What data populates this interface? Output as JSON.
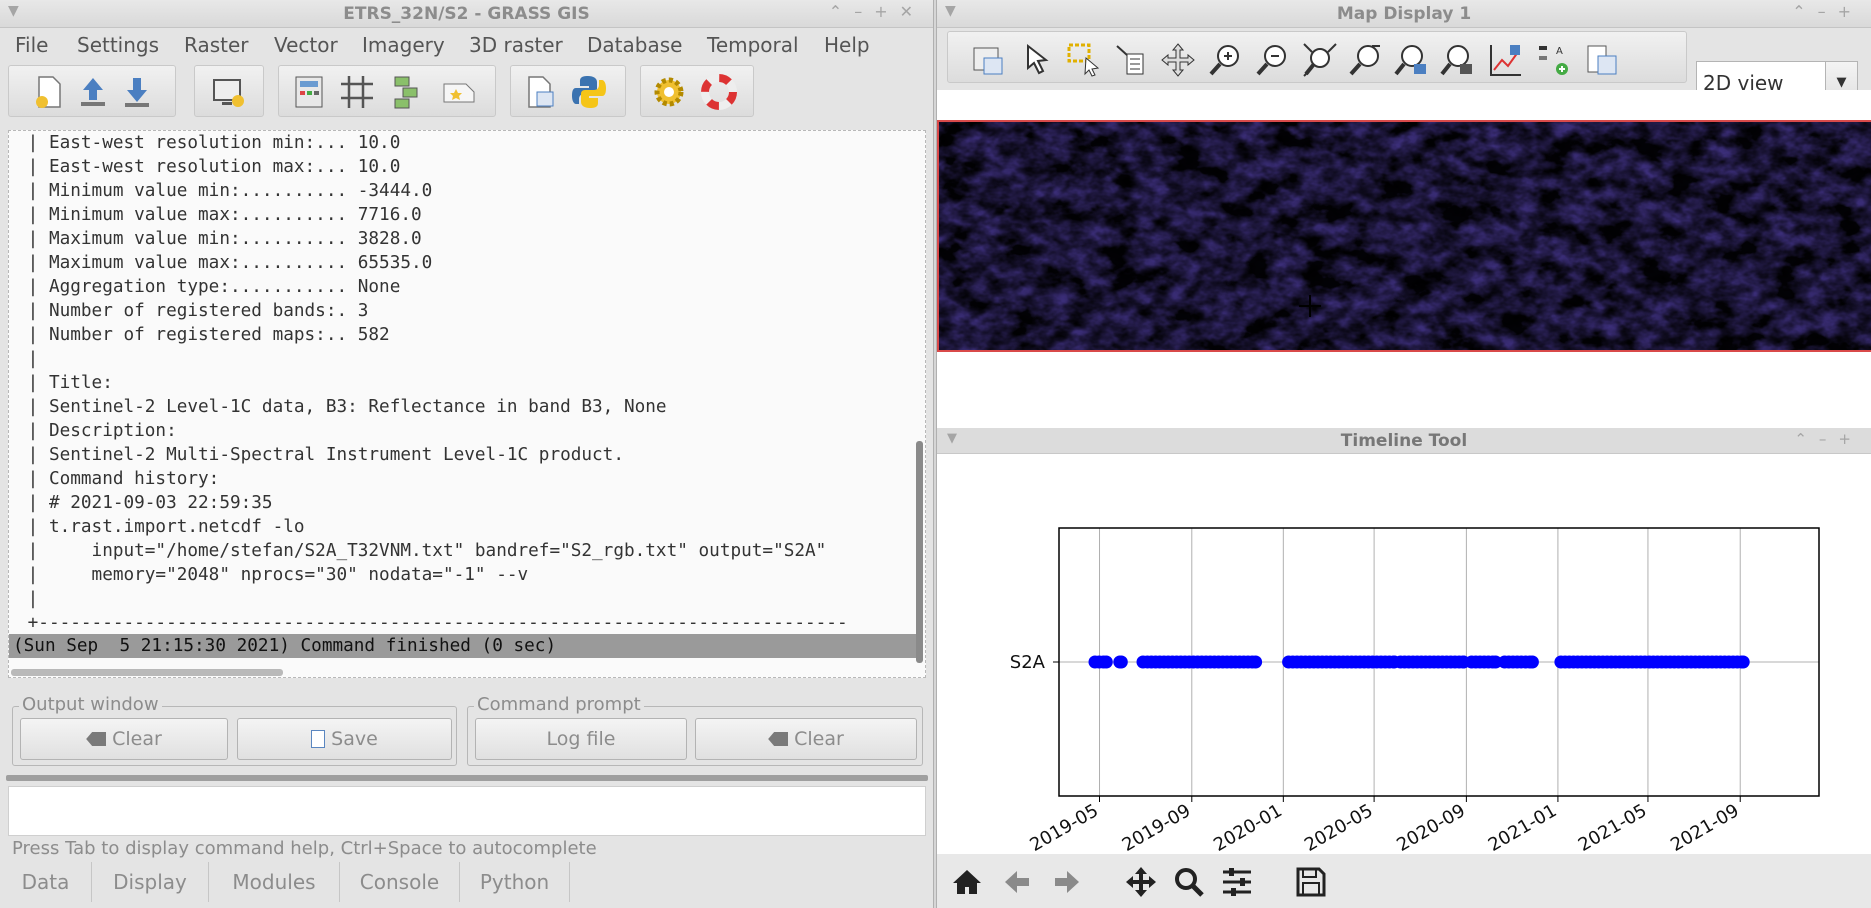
{
  "grass": {
    "title": "ETRS_32N/S2 - GRASS GIS",
    "menu": [
      "File",
      "Settings",
      "Raster",
      "Vector",
      "Imagery",
      "3D raster",
      "Database",
      "Temporal",
      "Help"
    ],
    "console_lines": [
      " | East-west resolution min:... 10.0",
      " | East-west resolution max:... 10.0",
      " | Minimum value min:.......... -3444.0",
      " | Minimum value max:.......... 7716.0",
      " | Maximum value min:.......... 3828.0",
      " | Maximum value max:.......... 65535.0",
      " | Aggregation type:........... None",
      " | Number of registered bands:. 3",
      " | Number of registered maps:.. 582",
      " |",
      " | Title:",
      " | Sentinel-2 Level-1C data, B3: Reflectance in band B3, None",
      " | Description:",
      " | Sentinel-2 Multi-Spectral Instrument Level-1C product.",
      " | Command history:",
      " | # 2021-09-03 22:59:35",
      " | t.rast.import.netcdf -lo",
      " |     input=\"/home/stefan/S2A_T32VNM.txt\" bandref=\"S2_rgb.txt\" output=\"S2A\"",
      " |     memory=\"2048\" nprocs=\"30\" nodata=\"-1\" --v",
      " |",
      " +----------------------------------------------------------------------------"
    ],
    "finished": "(Sun Sep  5 21:15:30 2021) Command finished (0 sec)",
    "output_window": {
      "legend": "Output window",
      "clear": "Clear",
      "save": "Save"
    },
    "command_prompt": {
      "legend": "Command prompt",
      "logfile": "Log file",
      "clear": "Clear"
    },
    "hint": "Press Tab to display command help, Ctrl+Space to autocomplete",
    "tabs": [
      "Data",
      "Display",
      "Modules",
      "Console",
      "Python"
    ]
  },
  "map": {
    "title": "Map Display 1",
    "view_mode": "2D view"
  },
  "timeline": {
    "title": "Timeline Tool",
    "chart_data": {
      "type": "scatter",
      "title": "",
      "xlabel": "",
      "ylabel": "",
      "categories": [
        "S2A"
      ],
      "x_ticks": [
        "2019-05",
        "2019-09",
        "2020-01",
        "2020-05",
        "2020-09",
        "2021-01",
        "2021-05",
        "2021-09"
      ],
      "xlim": [
        "2019-03-08",
        "2021-12-15"
      ],
      "grid": true,
      "marker_color": "#0000ff",
      "series": [
        {
          "date_ranges": [
            [
              "2019-04-25",
              "2019-05-10"
            ],
            [
              "2019-05-28",
              "2019-05-30"
            ],
            [
              "2019-06-28",
              "2019-11-25"
            ],
            [
              "2020-01-08",
              "2020-05-28"
            ],
            [
              "2020-06-05",
              "2020-08-28"
            ],
            [
              "2020-09-08",
              "2020-10-10"
            ],
            [
              "2020-10-22",
              "2020-11-28"
            ],
            [
              "2021-01-05",
              "2021-09-05"
            ]
          ]
        }
      ]
    }
  }
}
